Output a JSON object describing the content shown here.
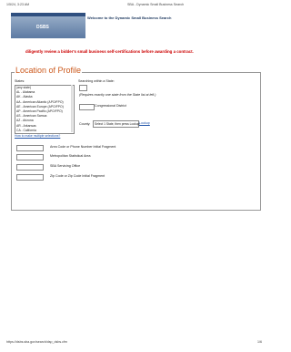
{
  "print_header": {
    "datetime": "1/5/24, 3:23 AM",
    "title": "SBA - Dynamic Small Business Search"
  },
  "banner": {
    "logo": "DSBS",
    "welcome": "Welcome to the Dynamic Small Business Search"
  },
  "warning": "diligently review a bidder's small business self-certifications before awarding a contract.",
  "section": {
    "legend": "Location of Profile"
  },
  "states": {
    "label": "States:",
    "options": [
      "(any state)",
      "AL - Alabama",
      "AK - Alaska",
      "AA - American Atlantic (APO/FPO)",
      "AE - American Europe (APO/FPO)",
      "AP - American Pacific (APO/FPO)",
      "AS - American Samoa",
      "AZ - Arizona",
      "AR - Arkansas",
      "CA - California"
    ],
    "multi_link": "How to make multiple selections?"
  },
  "searching": {
    "label": "Searching within a State:",
    "requires_text": "(Requires exactly one state from the State list at left.)",
    "congressional_label": "Congressional District",
    "county_label": "County:",
    "county_value": "Select 1 State, then press Lookup",
    "lookup_label": "Lookup"
  },
  "fields": [
    {
      "label": "Area Code or Phone Number Initial Fragment"
    },
    {
      "label": "Metropolitan Statistical Area"
    },
    {
      "label": "SBA Servicing Office"
    },
    {
      "label": "Zip Code or Zip Code Initial Fragment"
    }
  ],
  "footer": {
    "url": "https://dsbs.sba.gov/search/dsp_dsbs.cfm",
    "page": "1/6"
  }
}
